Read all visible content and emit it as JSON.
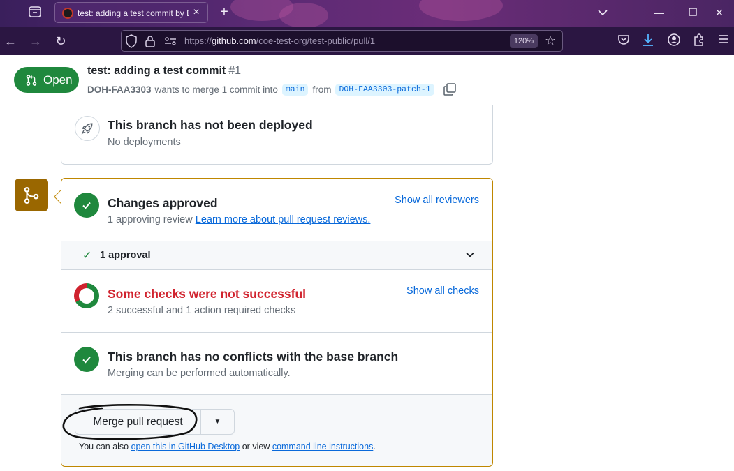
{
  "browser": {
    "tab_title": "test: adding a test commit by DOH-FAA3303",
    "url_scheme": "https://",
    "url_host": "github.com",
    "url_path": "/coe-test-org/test-public/pull/1",
    "zoom": "120%"
  },
  "pr": {
    "state": "Open",
    "title": "test: adding a test commit",
    "number": "#1",
    "author": "DOH-FAA3303",
    "meta_text": "wants to merge 1 commit into",
    "base_branch": "main",
    "from_text": "from",
    "head_branch": "DOH-FAA3303-patch-1"
  },
  "deployment": {
    "title": "This branch has not been deployed",
    "subtitle": "No deployments"
  },
  "review": {
    "title": "Changes approved",
    "subtitle": "1 approving review",
    "learn_link": "Learn more about pull request reviews.",
    "side_link": "Show all reviewers",
    "approval_count": "1 approval"
  },
  "checks": {
    "title": "Some checks were not successful",
    "subtitle": "2 successful and 1 action required checks",
    "side_link": "Show all checks",
    "successful": 2,
    "action_required": 1
  },
  "conflicts": {
    "title": "This branch has no conflicts with the base branch",
    "subtitle": "Merging can be performed automatically."
  },
  "merge": {
    "button_label": "Merge pull request",
    "footer_prefix": "You can also",
    "desktop_link": "open this in GitHub Desktop",
    "footer_middle": "or view",
    "cli_link": "command line instructions",
    "footer_suffix": "."
  },
  "colors": {
    "success": "#1f883d",
    "danger": "#d1242f",
    "link": "#0969da",
    "attention": "#9a6700"
  }
}
